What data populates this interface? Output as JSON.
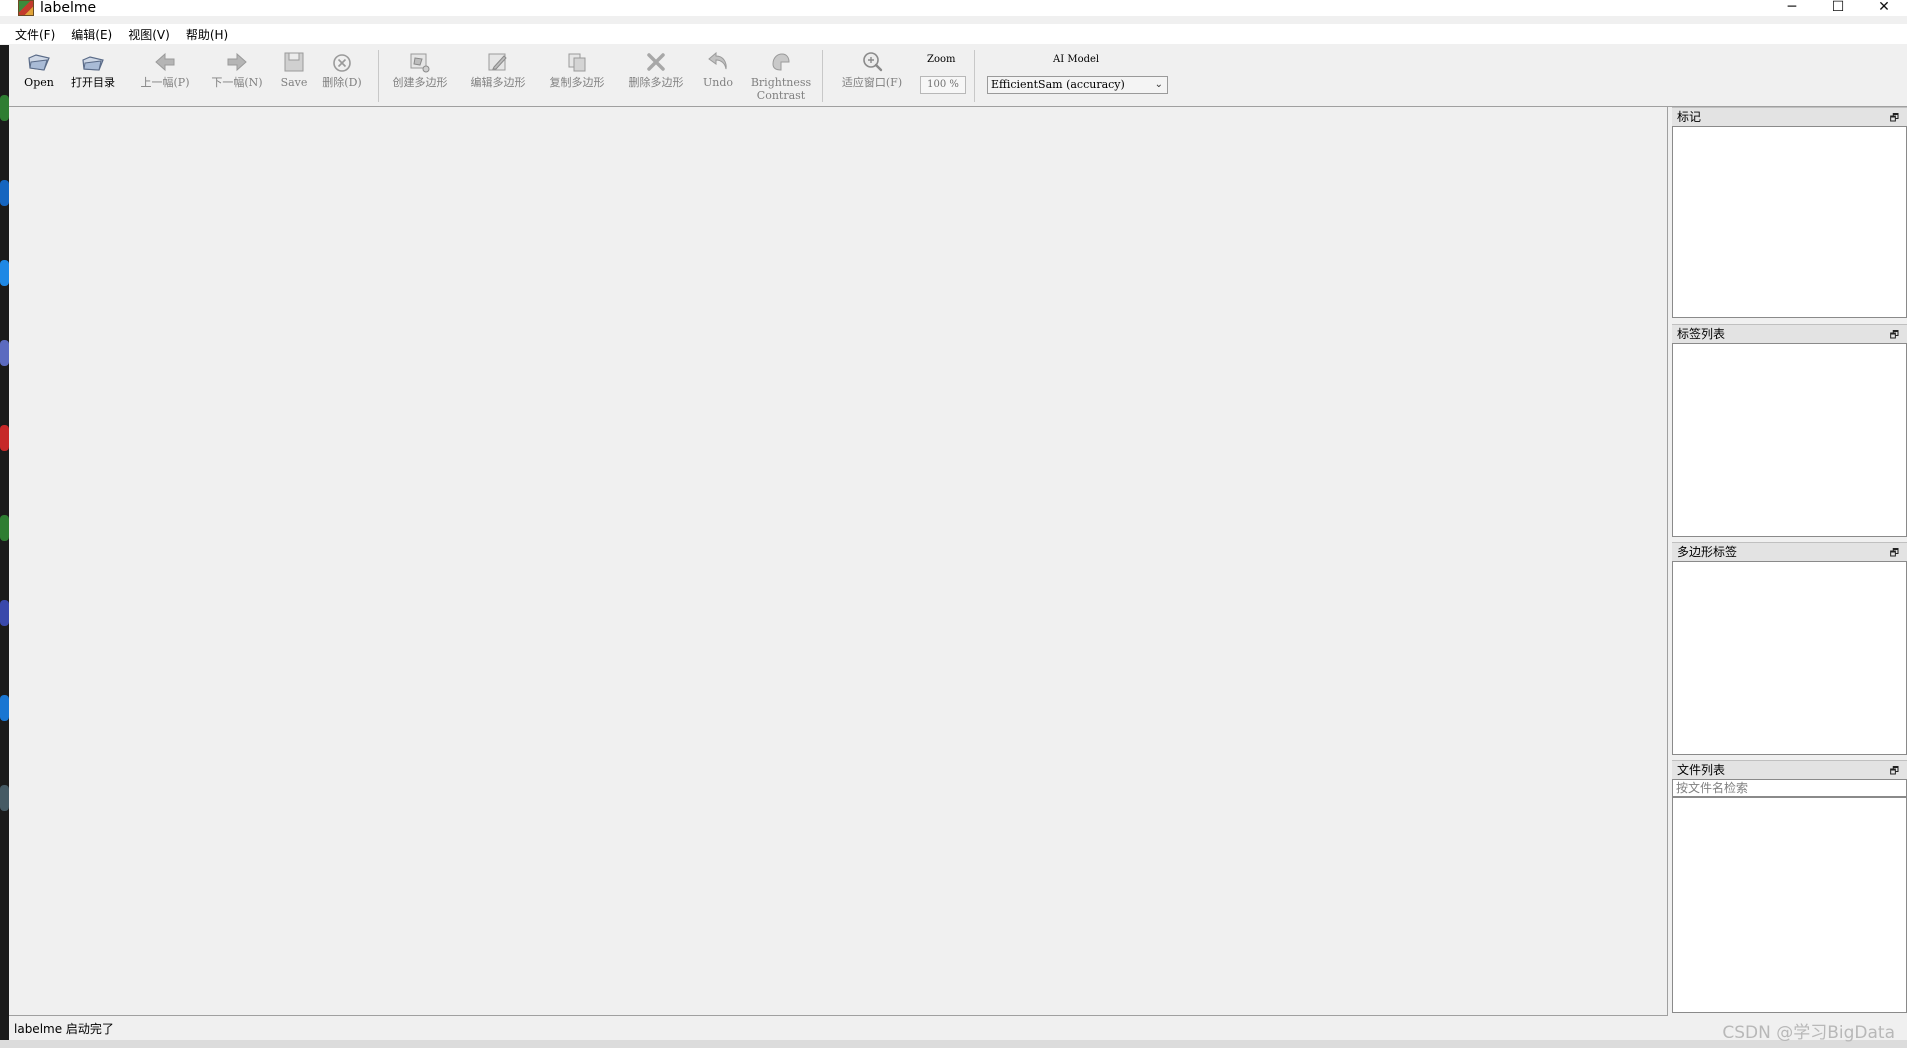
{
  "window": {
    "title": "labelme",
    "controls": {
      "minimize": "─",
      "maximize": "☐",
      "close": "✕"
    }
  },
  "menubar": {
    "items": [
      "文件(F)",
      "编辑(E)",
      "视图(V)",
      "帮助(H)"
    ]
  },
  "toolbar": {
    "open": "Open",
    "open_dir": "打开目录",
    "prev": "上一幅(P)",
    "next": "下一幅(N)",
    "save": "Save",
    "delete_file": "删除(D)",
    "create_polygon": "创建多边形",
    "edit_polygon": "编辑多边形",
    "copy_polygon": "复制多边形",
    "delete_polygon": "删除多边形",
    "undo": "Undo",
    "brightness_line1": "Brightness",
    "brightness_line2": "Contrast",
    "fit_window": "适应窗口(F)",
    "zoom_label": "Zoom",
    "zoom_value": "100 %",
    "ai_model_label": "AI Model",
    "ai_model_selected": "EfficientSam (accuracy)"
  },
  "docks": {
    "flags": {
      "title": "标记"
    },
    "label_list": {
      "title": "标签列表"
    },
    "polygon_labels": {
      "title": "多边形标签"
    },
    "file_list": {
      "title": "文件列表",
      "search_placeholder": "按文件名检索"
    }
  },
  "status": {
    "message": "labelme 启动完了"
  },
  "watermark": "CSDN @学习BigData",
  "colors": {
    "background": "#f0f0f0",
    "dock_title": "#e3e3e3",
    "disabled_text": "#808080"
  }
}
